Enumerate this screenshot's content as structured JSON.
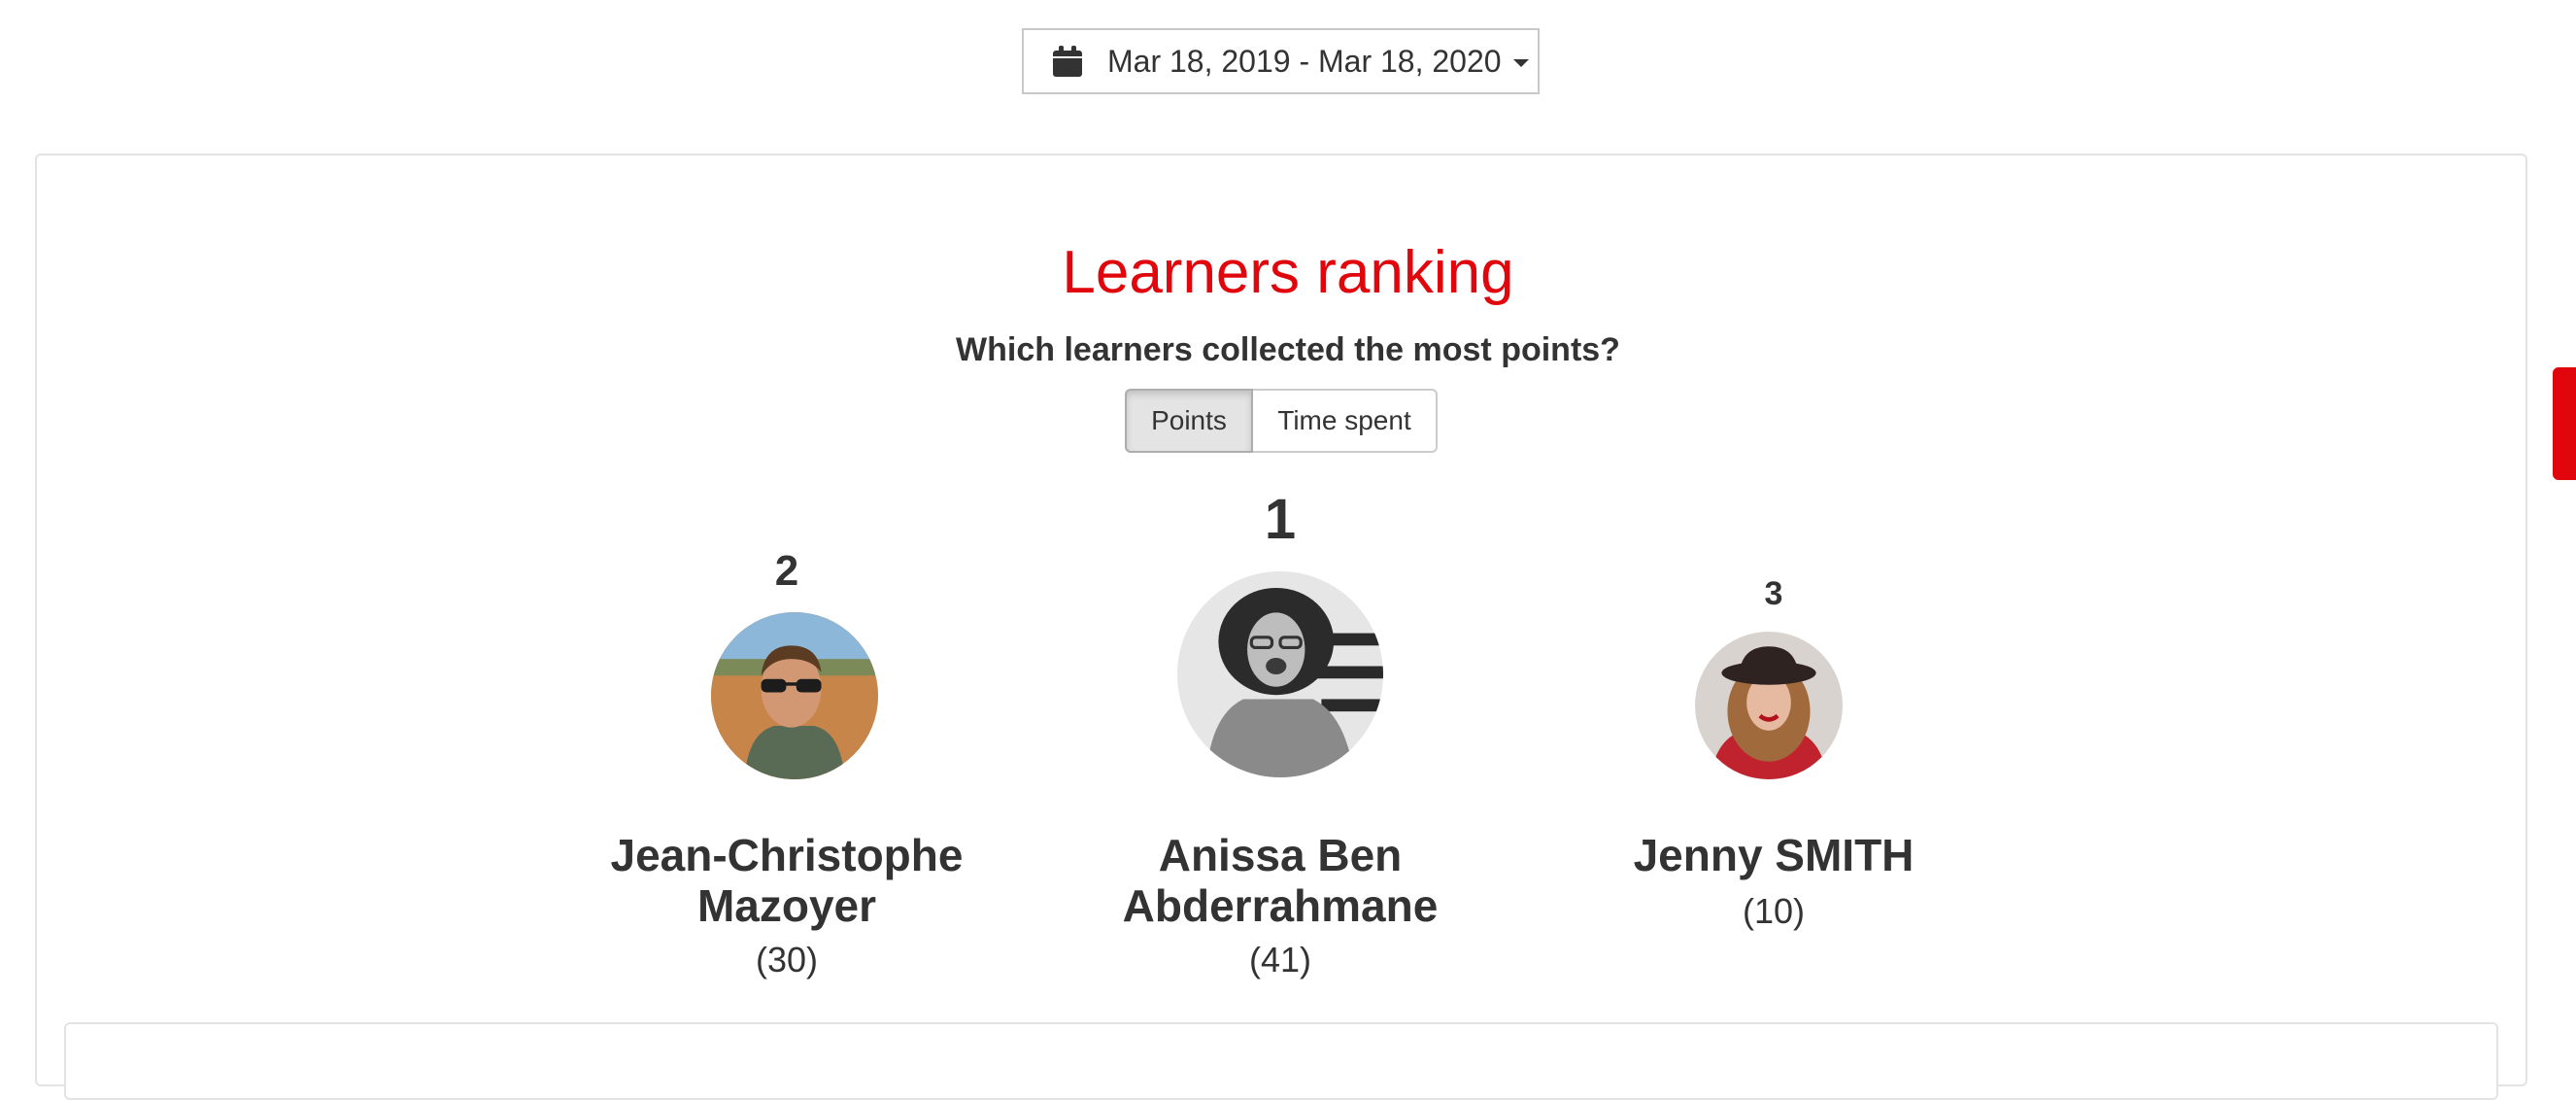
{
  "date_range": {
    "label": "Mar 18, 2019 - Mar 18, 2020",
    "icon": "calendar-icon",
    "dropdown_icon": "caret-down-icon"
  },
  "ranking": {
    "title": "Learners ranking",
    "subtitle": "Which learners collected the most points?",
    "toggle": {
      "points_label": "Points",
      "time_label": "Time spent",
      "selected": "Points"
    },
    "podium": [
      {
        "rank": "2",
        "name_line1": "Jean-Christophe",
        "name_line2": "Mazoyer",
        "points": "(30)"
      },
      {
        "rank": "1",
        "name_line1": "Anissa Ben",
        "name_line2": "Abderrahmane",
        "points": "(41)"
      },
      {
        "rank": "3",
        "name_line1": "Jenny SMITH",
        "name_line2": "",
        "points": "(10)"
      }
    ]
  },
  "colors": {
    "accent": "#e0060c",
    "text": "#333333",
    "border": "#e3e3e3"
  }
}
